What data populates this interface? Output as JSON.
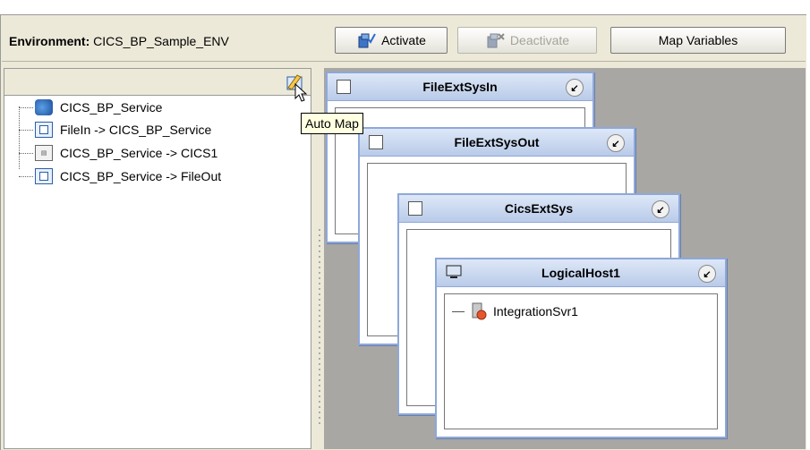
{
  "toolbar": {
    "environment_label": "Environment:",
    "environment_name": "CICS_BP_Sample_ENV",
    "activate_label": "Activate",
    "deactivate_label": "Deactivate",
    "map_variables_label": "Map Variables"
  },
  "tooltip": {
    "text": "Auto Map"
  },
  "tree": {
    "items": [
      {
        "label": "CICS_BP_Service",
        "icon": "service-icon"
      },
      {
        "label": "FileIn -> CICS_BP_Service",
        "icon": "document-icon"
      },
      {
        "label": "CICS_BP_Service -> CICS1",
        "icon": "cics-icon"
      },
      {
        "label": "CICS_BP_Service -> FileOut",
        "icon": "document-icon"
      }
    ]
  },
  "windows": [
    {
      "title": "FileExtSysIn"
    },
    {
      "title": "FileExtSysOut"
    },
    {
      "title": "CicsExtSys"
    },
    {
      "title": "LogicalHost1"
    }
  ],
  "logical_host": {
    "server": "IntegrationSvr1"
  },
  "colors": {
    "tooltip_bg": "#ffffe1",
    "canvas_bg": "#a8a7a4",
    "window_title": "#b9cbe9"
  }
}
